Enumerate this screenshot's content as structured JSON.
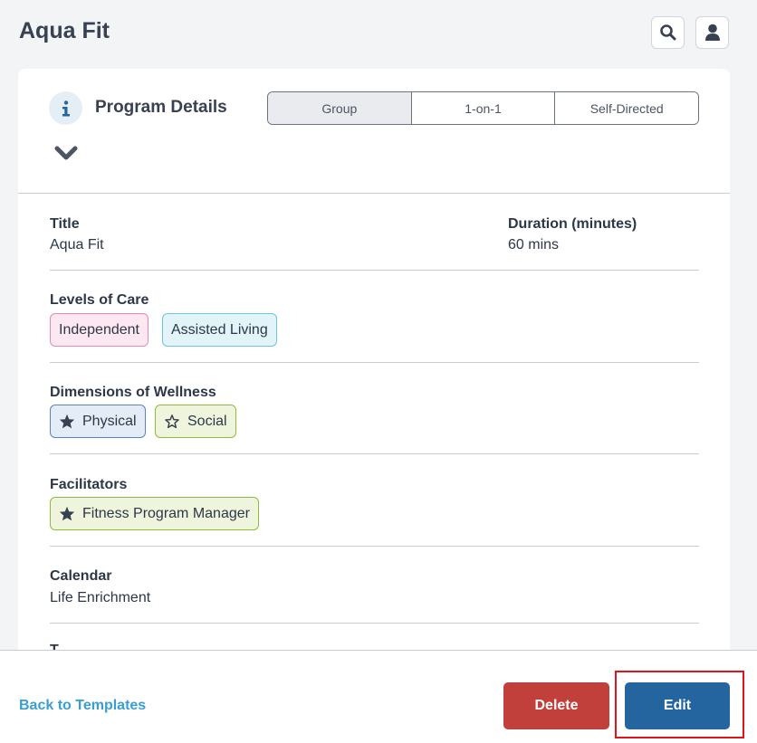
{
  "header": {
    "title": "Aqua Fit",
    "search_icon": "search-icon",
    "user_icon": "user-icon"
  },
  "program_details": {
    "section_title": "Program Details",
    "info_icon": "info-icon",
    "collapse_icon": "chevron-down-icon",
    "tabs": [
      {
        "label": "Group",
        "active": true
      },
      {
        "label": "1-on-1",
        "active": false
      },
      {
        "label": "Self-Directed",
        "active": false
      }
    ]
  },
  "fields": {
    "title_label": "Title",
    "title_value": "Aqua Fit",
    "duration_label": "Duration (minutes)",
    "duration_value": "60 mins",
    "levels_label": "Levels of Care",
    "levels": [
      "Independent",
      "Assisted Living"
    ],
    "wellness_label": "Dimensions of Wellness",
    "wellness": [
      {
        "label": "Physical",
        "icon": "star-filled-icon"
      },
      {
        "label": "Social",
        "icon": "star-outline-icon"
      }
    ],
    "facilitators_label": "Facilitators",
    "facilitators": [
      {
        "label": "Fitness Program Manager",
        "icon": "star-filled-icon"
      }
    ],
    "calendar_label": "Calendar",
    "calendar_value": "Life Enrichment",
    "next_label_partial": "T"
  },
  "footer": {
    "back_link": "Back to Templates",
    "delete_label": "Delete",
    "edit_label": "Edit"
  },
  "colors": {
    "primary": "#2465a0",
    "danger": "#c2403b",
    "link": "#3a9fd0",
    "highlight": "#e0141a"
  }
}
